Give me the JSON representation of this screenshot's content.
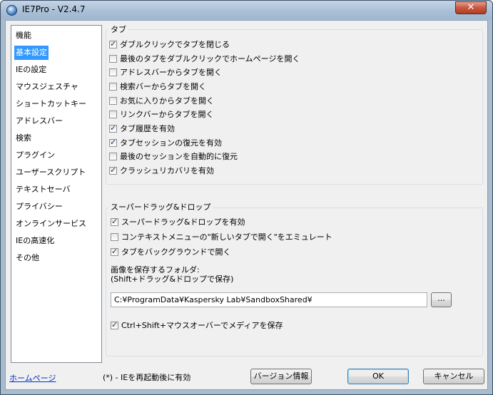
{
  "window": {
    "title": "IE7Pro - V2.4.7",
    "close_label": "✕"
  },
  "nav": {
    "items": [
      {
        "label": "機能",
        "selected": false
      },
      {
        "label": "基本設定",
        "selected": true
      },
      {
        "label": "IEの設定",
        "selected": false
      },
      {
        "label": "マウスジェスチャ",
        "selected": false
      },
      {
        "label": "ショートカットキー",
        "selected": false
      },
      {
        "label": "アドレスバー",
        "selected": false
      },
      {
        "label": "検索",
        "selected": false
      },
      {
        "label": "プラグイン",
        "selected": false
      },
      {
        "label": "ユーザースクリプト",
        "selected": false
      },
      {
        "label": "テキストセーバ",
        "selected": false
      },
      {
        "label": "プライバシー",
        "selected": false
      },
      {
        "label": "オンラインサービス",
        "selected": false
      },
      {
        "label": "IEの高速化",
        "selected": false
      },
      {
        "label": "その他",
        "selected": false
      }
    ]
  },
  "tab_group": {
    "label": "タブ",
    "options": [
      {
        "label": "ダブルクリックでタブを閉じる",
        "checked": true
      },
      {
        "label": "最後のタブをダブルクリックでホームページを開く",
        "checked": false
      },
      {
        "label": "アドレスバーからタブを開く",
        "checked": false
      },
      {
        "label": "検索バーからタブを開く",
        "checked": false
      },
      {
        "label": "お気に入りからタブを開く",
        "checked": false
      },
      {
        "label": "リンクバーからタブを開く",
        "checked": false
      },
      {
        "label": "タブ履歴を有効",
        "checked": true
      },
      {
        "label": "タブセッションの復元を有効",
        "checked": true
      },
      {
        "label": "最後のセッションを自動的に復元",
        "checked": false
      },
      {
        "label": "クラッシュリカバリを有効",
        "checked": true
      }
    ]
  },
  "drag_group": {
    "label": "スーパードラッグ&ドロップ",
    "options": [
      {
        "label": "スーパードラッグ&ドロップを有効",
        "checked": true
      },
      {
        "label": "コンテキストメニューの\"新しいタブで開く\"をエミュレート",
        "checked": false
      },
      {
        "label": "タブをバックグラウンドで開く",
        "checked": true
      }
    ],
    "folder_label_line1": "画像を保存するフォルダ:",
    "folder_label_line2": "(Shift+ドラッグ&ドロップで保存)",
    "folder_path": "C:¥ProgramData¥Kaspersky Lab¥SandboxShared¥",
    "browse_label": "...",
    "media_option": {
      "label": "Ctrl+Shift+マウスオーバーでメディアを保存",
      "checked": true
    }
  },
  "footer": {
    "homepage_link": "ホームページ",
    "note": "(*) - IEを再起動後に有効",
    "version_button": "バージョン情報",
    "ok_button": "OK",
    "cancel_button": "キャンセル"
  }
}
